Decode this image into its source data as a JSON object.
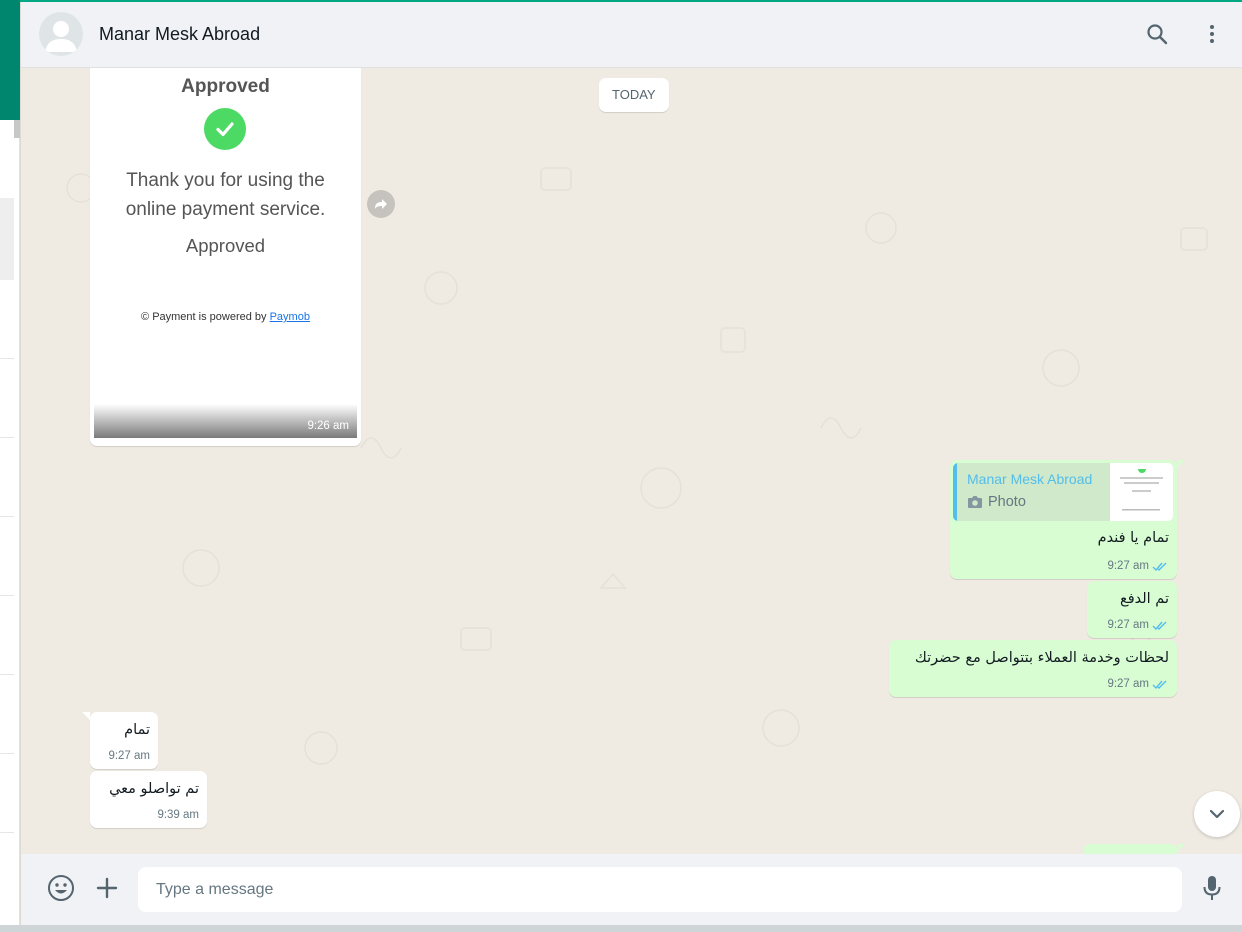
{
  "header": {
    "contact_name": "Manar Mesk Abroad",
    "search_icon": "search-icon",
    "menu_icon": "more-vertical-icon"
  },
  "chat": {
    "day_chip": "TODAY",
    "image_message": {
      "title": "Approved",
      "thank_you": "Thank you for using the online payment service.",
      "approved": "Approved",
      "powered_prefix": "© Payment is powered by",
      "powered_link": "Paymob",
      "time": "9:26 am"
    },
    "reply_message": {
      "quote_name": "Manar Mesk Abroad",
      "quote_type": "Photo",
      "text": "تمام يا فندم",
      "time": "9:27 am"
    },
    "out_messages": [
      {
        "text": "تم الدفع",
        "time": "9:27 am"
      },
      {
        "text": "لحظات وخدمة العملاء بتتواصل مع حضرتك",
        "time": "9:27 am"
      }
    ],
    "in_messages": [
      {
        "text": "تمام",
        "time": "9:27 am"
      },
      {
        "text": "تم تواصلو معي",
        "time": "9:39 am"
      }
    ]
  },
  "footer": {
    "placeholder": "Type a message",
    "emoji_icon": "emoji-icon",
    "attach_icon": "plus-icon",
    "mic_icon": "microphone-icon"
  },
  "colors": {
    "accent": "#00a884",
    "outgoing_bubble": "#d9fdd3",
    "incoming_bubble": "#ffffff",
    "chat_background": "#efeae2",
    "read_ticks": "#53bdeb"
  }
}
